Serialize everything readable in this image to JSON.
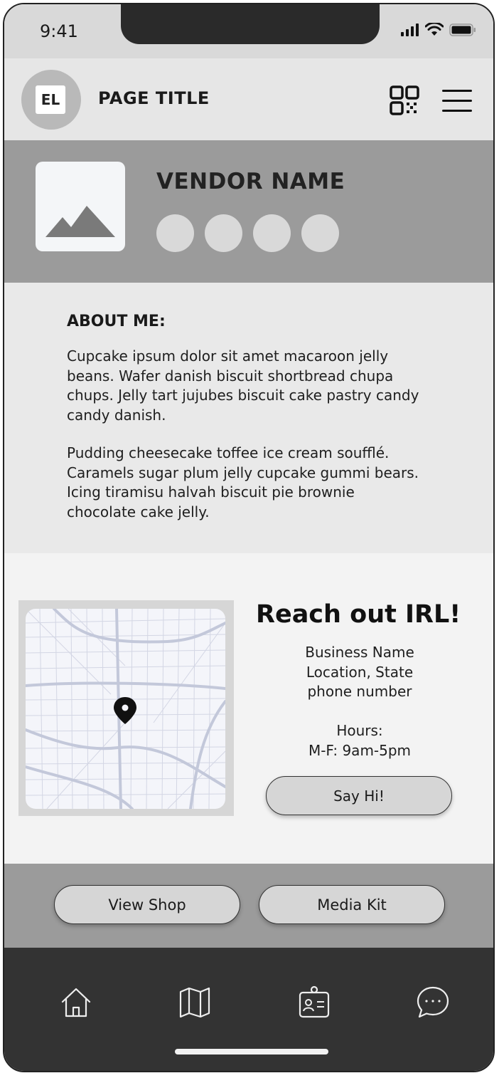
{
  "status_bar": {
    "time": "9:41"
  },
  "header": {
    "avatar_initials": "EL",
    "title": "PAGE TITLE",
    "qr_icon": "qr-code-icon",
    "menu_icon": "hamburger-menu-icon"
  },
  "vendor": {
    "name": "VENDOR NAME",
    "image_icon": "image-placeholder-icon",
    "social_dots": 4
  },
  "about": {
    "title": "ABOUT ME:",
    "paragraph1": "Cupcake ipsum dolor sit amet macaroon jelly beans. Wafer danish biscuit shortbread chupa chups. Jelly tart jujubes biscuit cake pastry candy candy danish.",
    "paragraph2": "Pudding cheesecake toffee ice cream soufflé. Caramels sugar plum jelly cupcake gummi bears. Icing tiramisu halvah biscuit pie brownie chocolate cake jelly."
  },
  "reach": {
    "title": "Reach out IRL!",
    "business_name": "Business Name",
    "location": "Location, State",
    "phone": "phone number",
    "hours_label": "Hours:",
    "hours_value": "M-F: 9am-5pm",
    "button_label": "Say Hi!"
  },
  "actions": {
    "view_shop": "View Shop",
    "media_kit": "Media Kit"
  },
  "tabbar": {
    "icons": [
      "home-icon",
      "map-icon",
      "id-card-icon",
      "chat-icon"
    ]
  },
  "colors": {
    "band_gray": "#9b9b9b",
    "tabbar": "#333333",
    "button": "#d6d6d6"
  }
}
